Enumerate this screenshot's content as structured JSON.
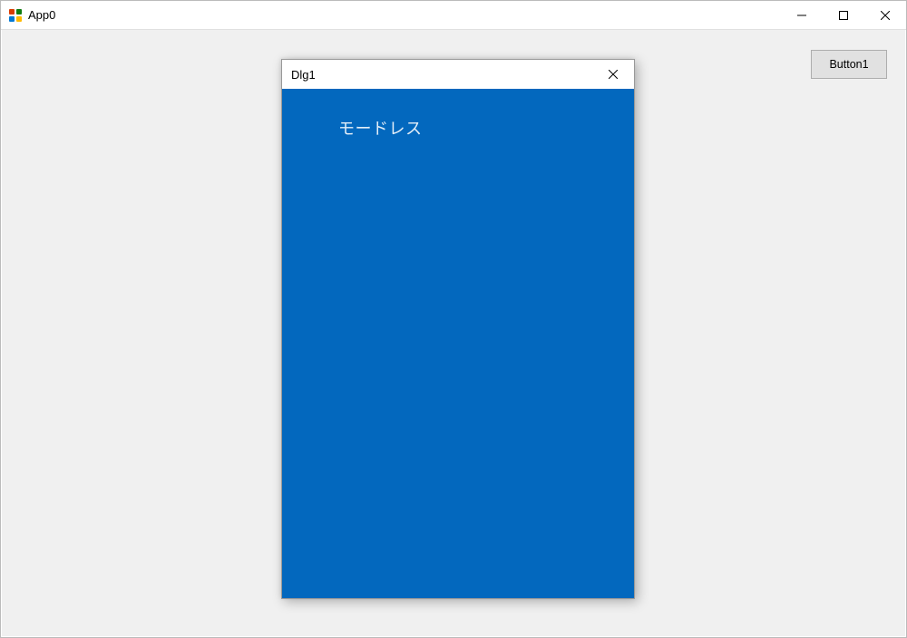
{
  "mainWindow": {
    "title": "App0"
  },
  "client": {
    "button1_label": "Button1"
  },
  "dialog": {
    "title": "Dlg1",
    "body_text": "モードレス"
  }
}
